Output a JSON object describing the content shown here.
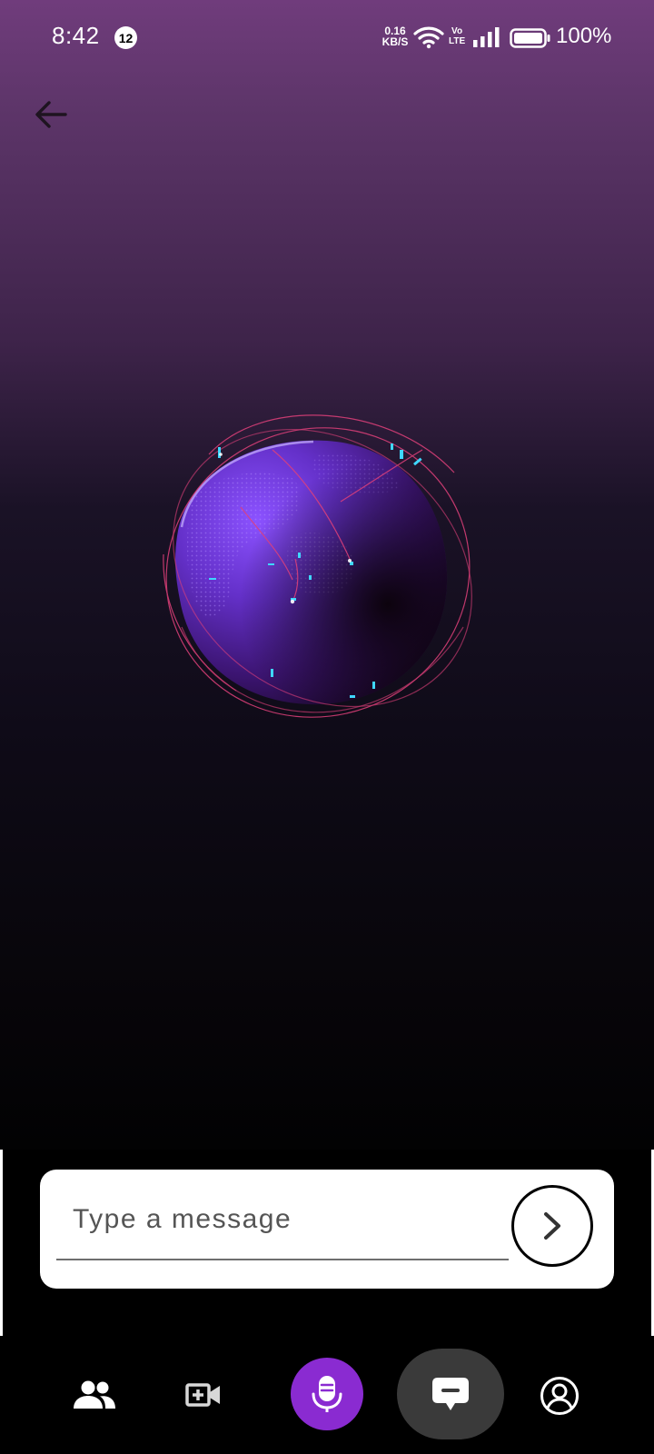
{
  "status_bar": {
    "time": "8:42",
    "notification_count": "12",
    "net_speed_value": "0.16",
    "net_speed_unit": "KB/S",
    "volte_top": "Vo",
    "volte_bottom": "LTE",
    "battery": "100%"
  },
  "composer": {
    "placeholder": "Type a message"
  },
  "icons": {
    "back": "arrow-left-icon",
    "send": "chevron-right-icon",
    "contacts": "people-icon",
    "video": "video-add-icon",
    "mic": "microphone-icon",
    "chat": "chat-bubble-icon",
    "profile": "account-circle-icon"
  },
  "colors": {
    "mic_button": "#8a2bd1",
    "chat_pill": "#3a3a3a",
    "composer_bg": "#ffffff",
    "top_gradient": "#703c7c"
  }
}
